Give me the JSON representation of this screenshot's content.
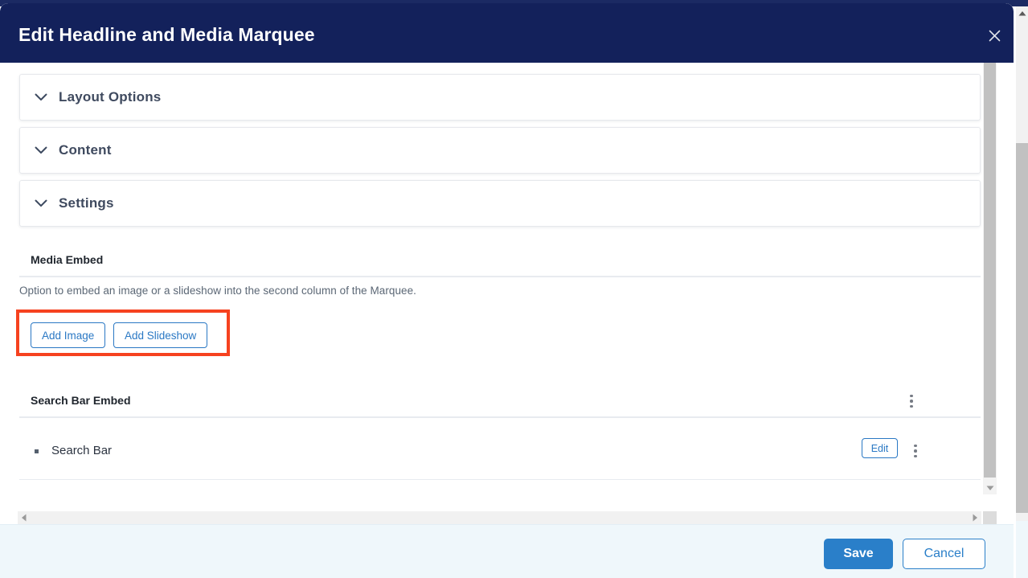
{
  "modal": {
    "title": "Edit Headline and Media Marquee",
    "close_icon": "close-icon",
    "header_color": "#13215b"
  },
  "accordions": [
    {
      "label": "Layout Options",
      "icon": "chevron-down-icon"
    },
    {
      "label": "Content",
      "icon": "chevron-down-icon"
    },
    {
      "label": "Settings",
      "icon": "chevron-down-icon"
    }
  ],
  "media_embed": {
    "title": "Media Embed",
    "description": "Option to embed an image or a slideshow into the second column of the Marquee.",
    "buttons": [
      {
        "label": "Add Image"
      },
      {
        "label": "Add Slideshow"
      }
    ],
    "annotation_color": "#f6421f"
  },
  "search_bar_embed": {
    "title": "Search Bar Embed",
    "menu_icon": "kebab-menu-icon",
    "rows": [
      {
        "label": "Search Bar",
        "edit_label": "Edit",
        "menu_icon": "kebab-menu-icon"
      }
    ]
  },
  "footer": {
    "save_label": "Save",
    "cancel_label": "Cancel",
    "save_color": "#2a7fc9",
    "background": "#eff7fb"
  },
  "scrollbars": {
    "vertical_inner": "scrollbar-vertical",
    "horizontal_inner": "scrollbar-horizontal",
    "window_vertical": "scrollbar-window"
  }
}
